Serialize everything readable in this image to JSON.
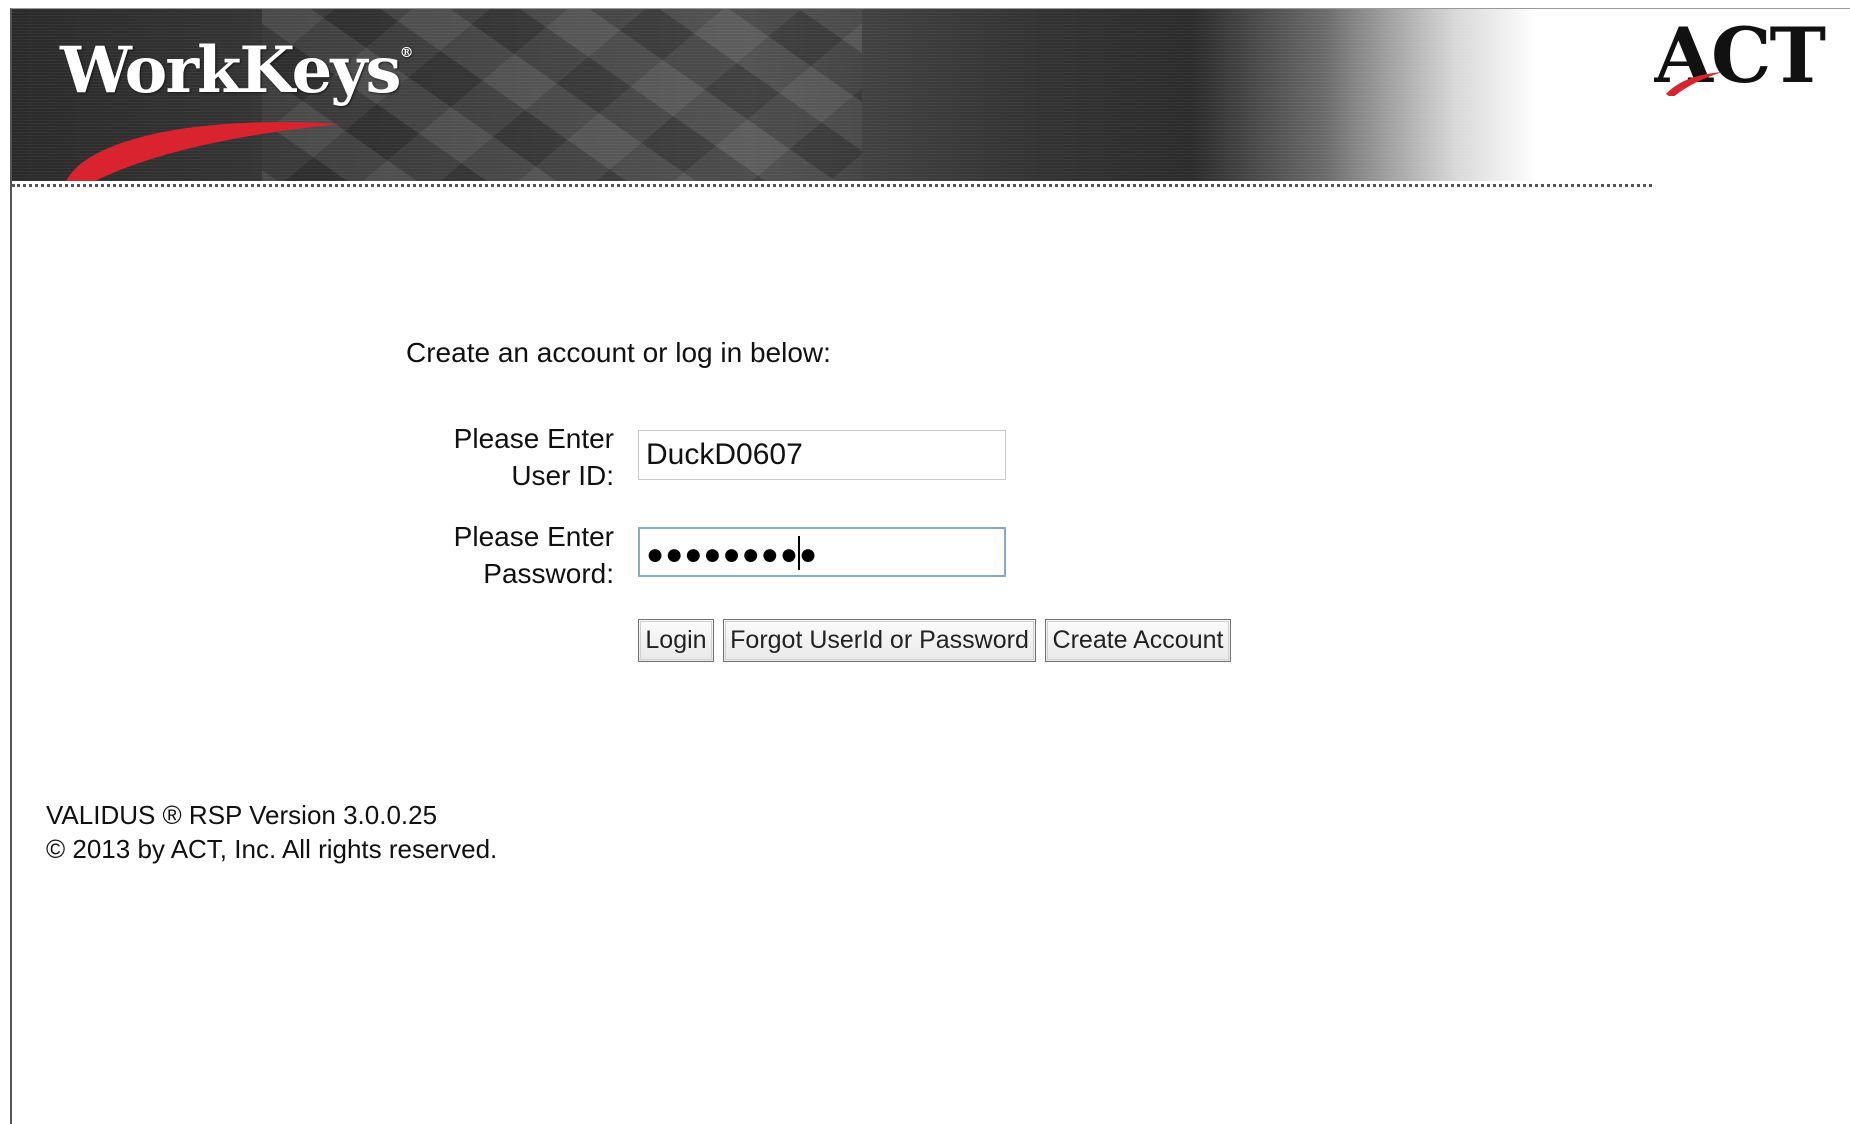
{
  "header": {
    "brand_logo": "WorkKeys",
    "brand_mark": "®",
    "company_logo": "ACT"
  },
  "form": {
    "intro": "Create an account or log in below:",
    "user_label_line1": "Please Enter",
    "user_label_line2": "User ID:",
    "user_value": "DuckD0607",
    "password_label_line1": "Please Enter",
    "password_label_line2": "Password:",
    "password_masked": "●●●●●●●●●"
  },
  "buttons": {
    "login": "Login",
    "forgot": "Forgot UserId or Password",
    "create": "Create Account"
  },
  "footer": {
    "version": "VALIDUS ® RSP Version 3.0.0.25",
    "copyright": "© 2013 by ACT, Inc. All rights reserved."
  },
  "colors": {
    "swoosh": "#d9232e",
    "banner_dark": "#2e2e2e",
    "focus_border": "#8aa8c8"
  }
}
